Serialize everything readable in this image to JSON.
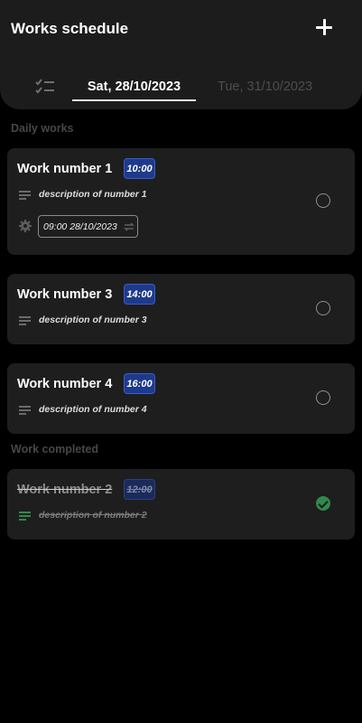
{
  "app": {
    "title": "Works schedule"
  },
  "icons": {
    "add": "plus-icon",
    "list_toggle": "checklist-icon",
    "description": "text-lines-icon",
    "reminder": "gear-icon",
    "repeat": "repeat-icon",
    "done": "check-icon"
  },
  "colors": {
    "time_badge": "#1e3a8a",
    "completed": "#2f8a4c",
    "card_bg": "#1e1e1e",
    "header_bg": "#1c1c1c"
  },
  "tabs": {
    "active_date": "Sat,  28/10/2023",
    "inactive_date": "Tue,  31/10/2023"
  },
  "sections": {
    "daily": "Daily works",
    "completed": "Work completed"
  },
  "works": {
    "w1": {
      "title": "Work number 1",
      "time": "10:00",
      "description": "description of number 1",
      "reminder": "09:00 28/10/2023"
    },
    "w3": {
      "title": "Work number 3",
      "time": "14:00",
      "description": "description of number 3"
    },
    "w4": {
      "title": "Work number 4",
      "time": "16:00",
      "description": "description of number 4"
    }
  },
  "completed_works": {
    "w2": {
      "title": "Work number 2",
      "time": "12:00",
      "description": "description of number 2"
    }
  }
}
